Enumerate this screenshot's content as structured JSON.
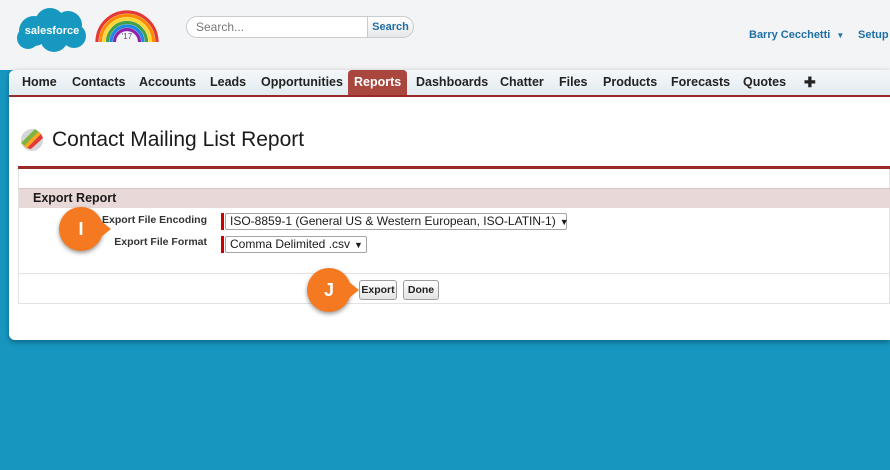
{
  "brand": {
    "logo_text": "salesforce",
    "badge_text": "'17"
  },
  "header": {
    "search_placeholder": "Search...",
    "search_button": "Search",
    "user_name": "Barry Cecchetti",
    "setup_label": "Setup"
  },
  "tabs": [
    {
      "label": "Home"
    },
    {
      "label": "Contacts"
    },
    {
      "label": "Accounts"
    },
    {
      "label": "Leads"
    },
    {
      "label": "Opportunities"
    },
    {
      "label": "Reports",
      "active": true
    },
    {
      "label": "Dashboards"
    },
    {
      "label": "Chatter"
    },
    {
      "label": "Files"
    },
    {
      "label": "Products"
    },
    {
      "label": "Forecasts"
    },
    {
      "label": "Quotes"
    },
    {
      "label": "✚"
    }
  ],
  "page": {
    "title": "Contact Mailing List Report"
  },
  "export_section": {
    "header": "Export Report",
    "encoding_label": "Export File Encoding",
    "encoding_value": "ISO-8859-1 (General US & Western European, ISO-LATIN-1)",
    "format_label": "Export File Format",
    "format_value": "Comma Delimited .csv",
    "export_button": "Export",
    "done_button": "Done"
  },
  "callouts": {
    "encoding_marker": "I",
    "export_marker": "J"
  },
  "colors": {
    "background": "#1797c0",
    "accent": "#9a2b24",
    "active_tab": "#a9473e",
    "callout": "#f47920",
    "link": "#1f6fa6"
  }
}
